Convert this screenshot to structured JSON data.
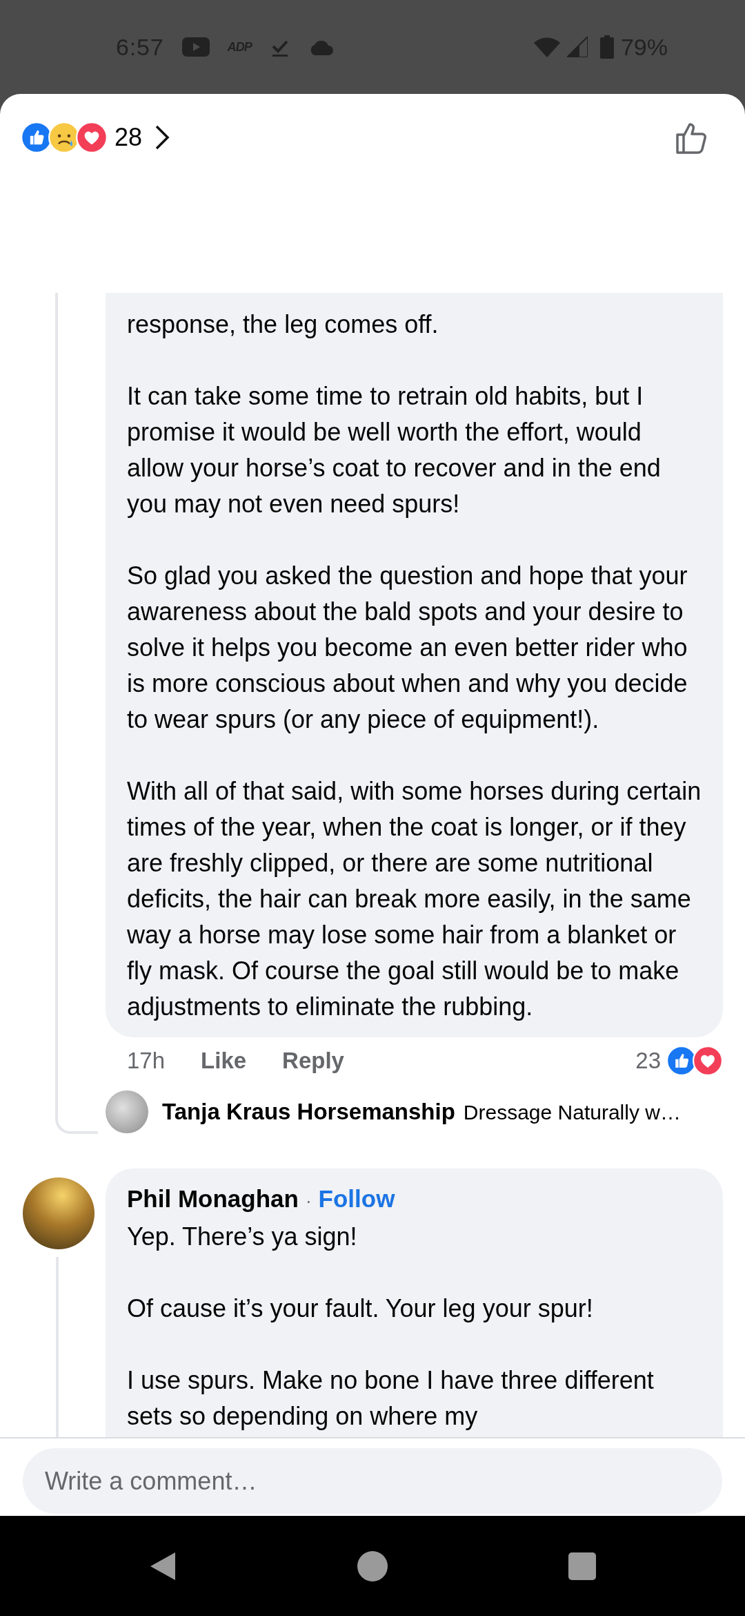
{
  "status_bar": {
    "time": "6:57",
    "logo_text": "ADP",
    "battery": "79%"
  },
  "header": {
    "reaction_count": "28"
  },
  "comments": [
    {
      "kind": "continuation",
      "paragraphs": [
        "response, the leg comes off.",
        "It can take some time to retrain old habits, but I promise it would be well worth the effort, would allow your horse’s coat to recover and in the end you may not even need spurs!",
        "So glad you asked the question and hope that your awareness about the bald spots and your desire to solve it helps you become an even better rider who is more conscious about when and why you decide to wear spurs (or any piece of equipment!).",
        "With all of that said, with some horses during certain times of the year, when the coat is longer, or if they are freshly clipped, or there are some nutritional deficits, the hair can break more easily, in the same way a horse may lose some hair from a blanket or fly mask. Of course the goal still would be to make adjustments to eliminate the rubbing."
      ],
      "time": "17h",
      "actions": [
        "Like",
        "Reply"
      ],
      "reaction_count": "23",
      "reply_preview": {
        "author": "Tanja Kraus Horsemanship",
        "snippet": "Dressage Naturally w…"
      }
    },
    {
      "kind": "full",
      "author": "Phil Monaghan",
      "separator": "·",
      "follow": "Follow",
      "paragraphs": [
        "Yep. There’s ya sign!",
        "Of cause it’s your fault. Your leg your spur!",
        "I use spurs. Make no bone I have three different sets so depending on where my"
      ]
    }
  ],
  "composer": {
    "placeholder": "Write a comment…"
  }
}
